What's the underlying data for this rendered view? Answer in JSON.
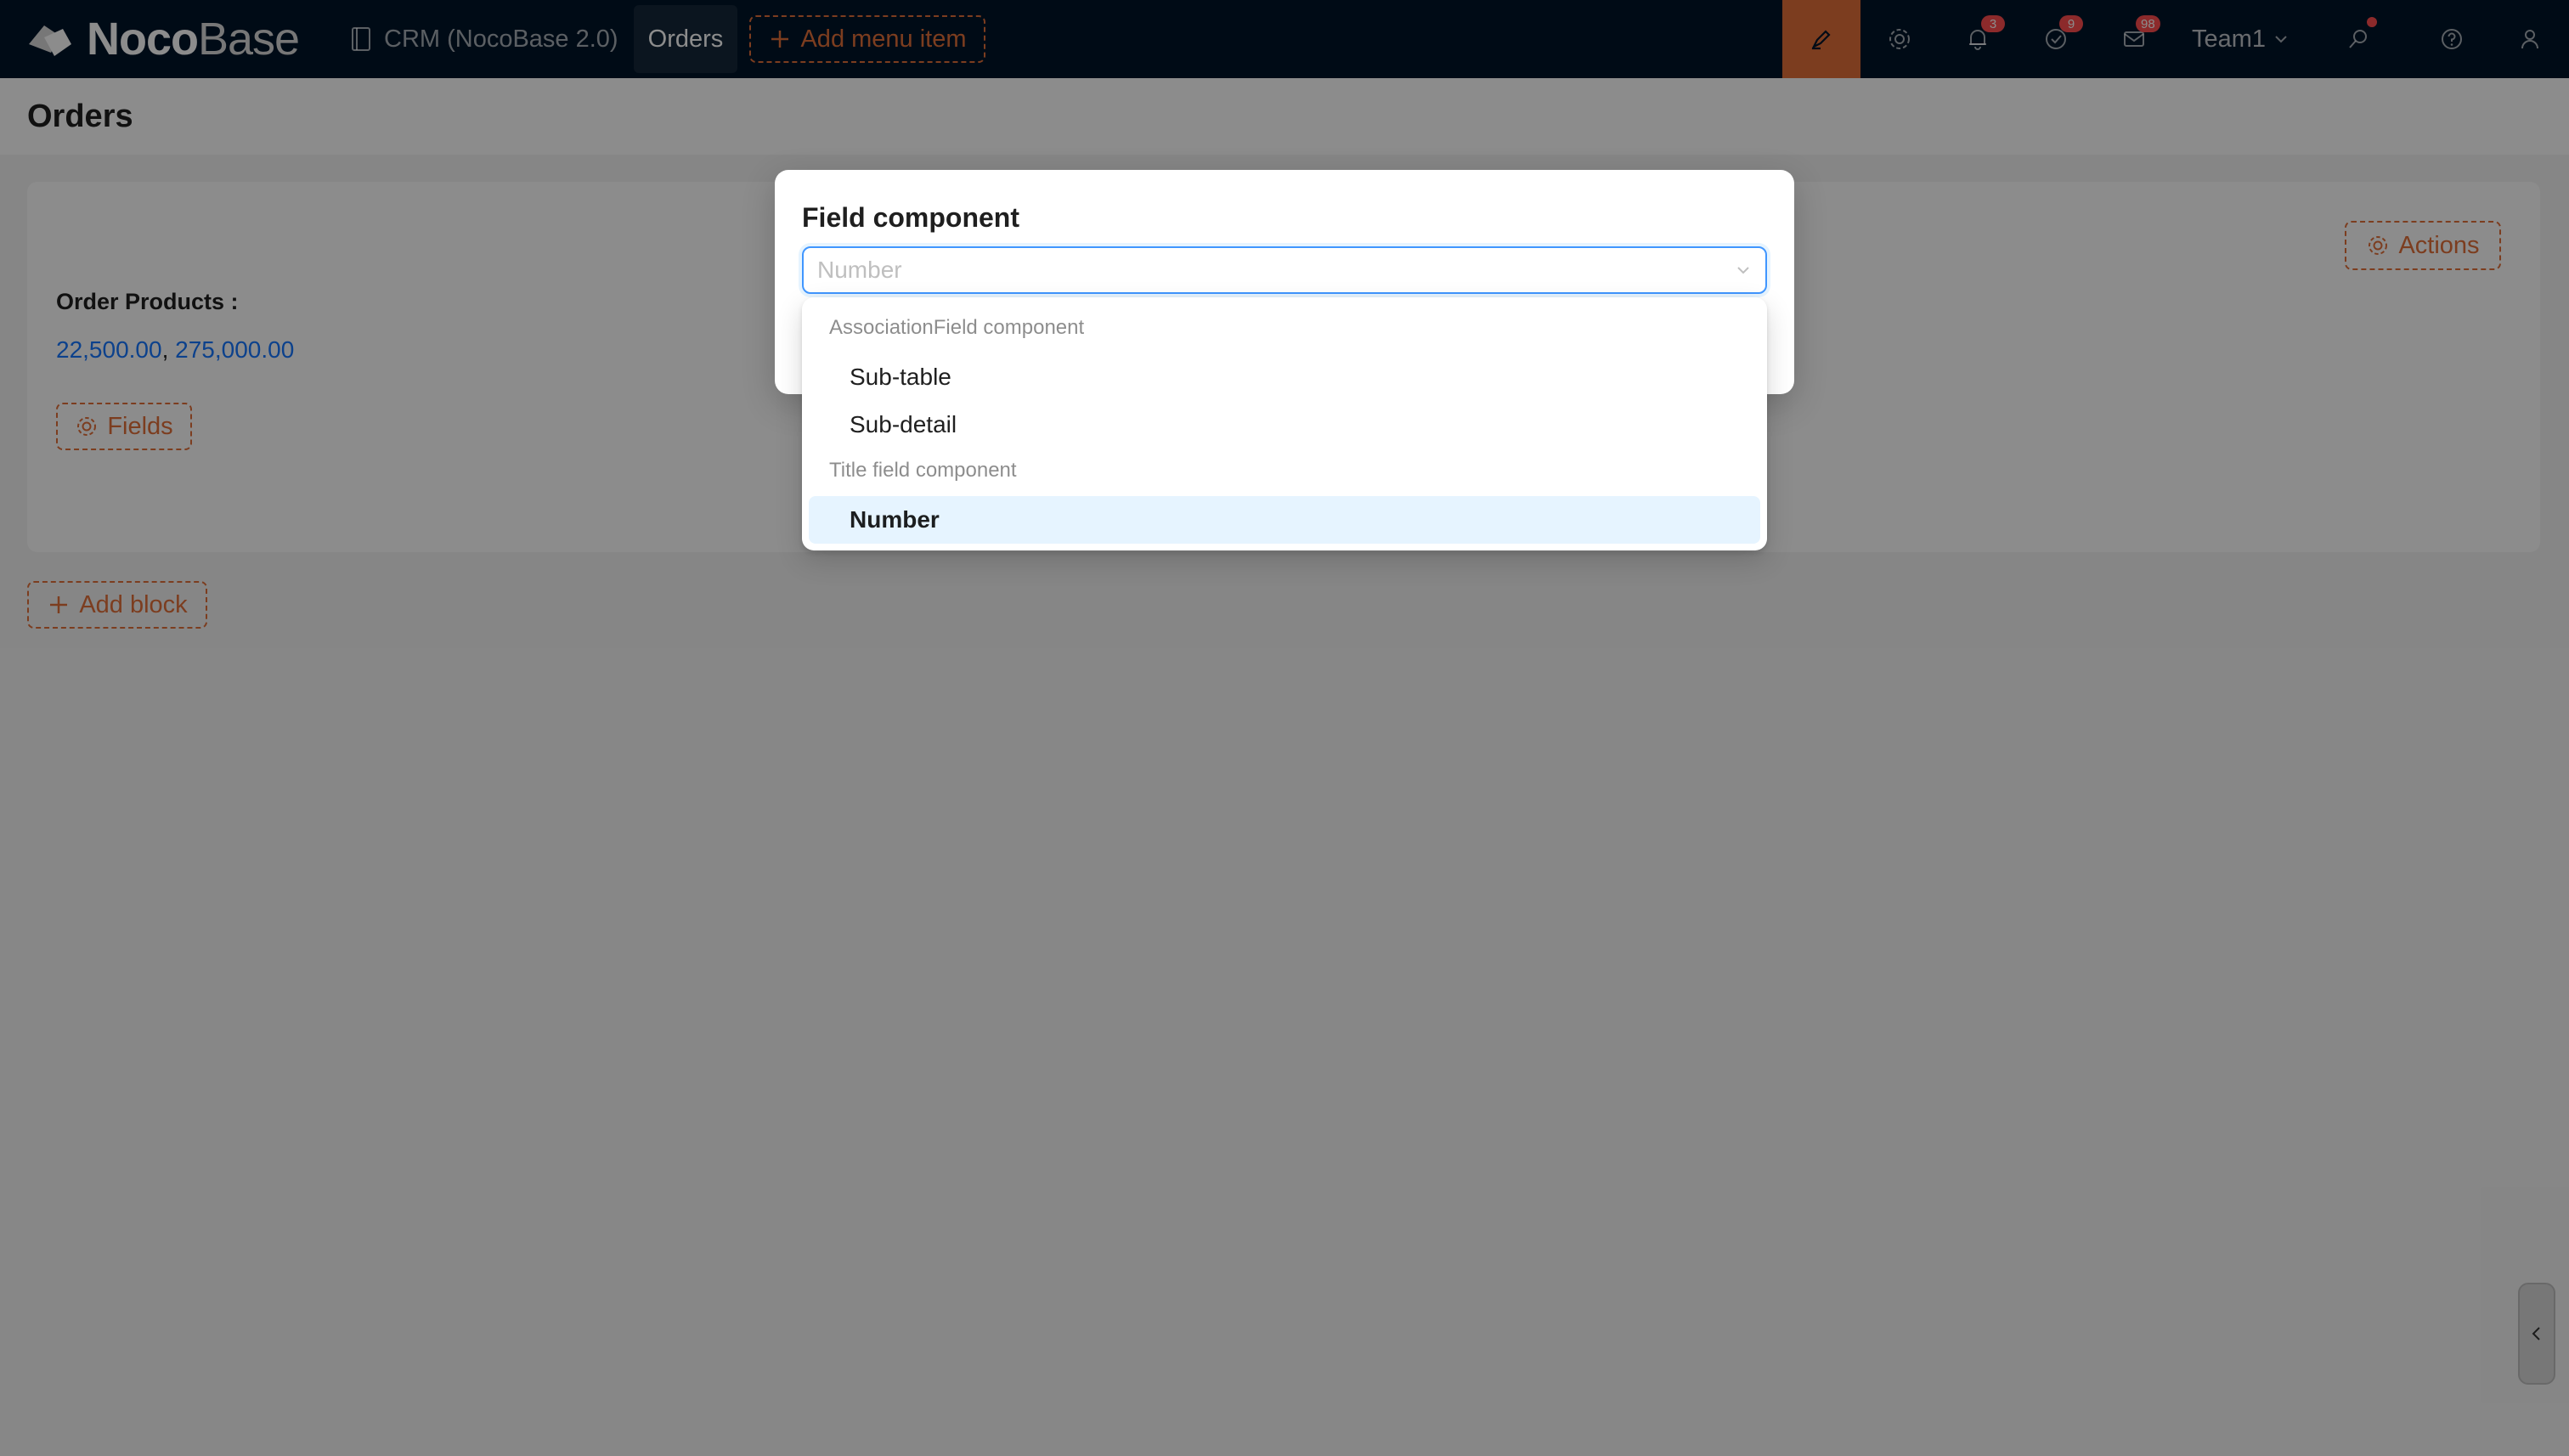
{
  "app": {
    "logo_bold": "Noco",
    "logo_light": "Base"
  },
  "nav": {
    "crm_label": "CRM (NocoBase 2.0)",
    "orders_label": "Orders",
    "add_menu_label": "Add menu item"
  },
  "header_right": {
    "notifications_count": "3",
    "tasks_count": "9",
    "messages_count": "98",
    "team_label": "Team1"
  },
  "page": {
    "title": "Orders"
  },
  "details_block": {
    "actions_label": "Actions",
    "field_label": "Order Products :",
    "values": [
      "22,500.00",
      "275,000.00"
    ],
    "separator": ",",
    "fields_label": "Fields"
  },
  "add_block_label": "Add block",
  "modal": {
    "title": "Field component",
    "select_placeholder": "Number"
  },
  "dropdown": {
    "groups": [
      {
        "label": "AssociationField component",
        "options": [
          "Sub-table",
          "Sub-detail"
        ]
      },
      {
        "label": "Title field component",
        "options": [
          "Number"
        ]
      }
    ],
    "selected": "Number"
  },
  "colors": {
    "topbar": "#001529",
    "accent_orange": "#e2703a",
    "link_blue": "#1677ff",
    "active_option_bg": "#e6f4ff",
    "badge_red": "#ff4d4f"
  }
}
